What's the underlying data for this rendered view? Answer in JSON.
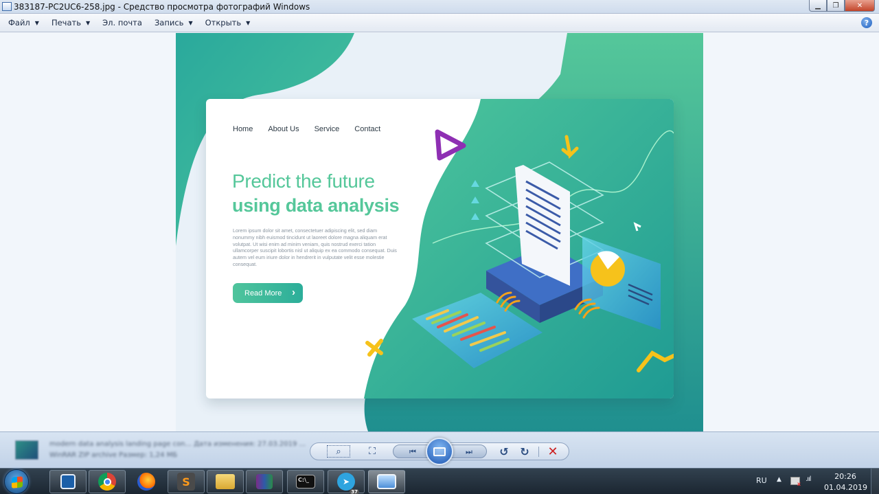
{
  "window": {
    "title": "383187-PC2UC6-258.jpg - Средство просмотра фотографий Windows",
    "minimize_glyph": "▁",
    "maximize_glyph": "❐",
    "close_glyph": "✕"
  },
  "menu": {
    "items": [
      {
        "label": "Файл",
        "dropdown": true
      },
      {
        "label": "Печать",
        "dropdown": true
      },
      {
        "label": "Эл. почта",
        "dropdown": false
      },
      {
        "label": "Запись",
        "dropdown": true
      },
      {
        "label": "Открыть",
        "dropdown": true
      }
    ],
    "dropdown_glyph": "▼",
    "help_glyph": "?"
  },
  "photo": {
    "nav": [
      "Home",
      "About Us",
      "Service",
      "Contact"
    ],
    "headline_light": "Predict the future",
    "headline_bold": "using data analysis",
    "body_text": "Lorem ipsum dolor sit amet, consectetuer adipiscing elit, sed diam nonummy nibh euismod tincidunt ut laoreet dolore magna aliquam erat volutpat. Ut wisi enim ad minim veniam, quis nostrud exerci tation ullamcorper suscipit lobortis nisl ut aliquip ex ea commodo consequat. Duis autem vel eum iriure dolor in hendrerit in vulputate velit esse molestie consequat.",
    "button_label": "Read More",
    "button_glyph": "›",
    "colors": {
      "green": "#55c79a",
      "teal": "#2aa99c",
      "dark_teal": "#1f8f8f"
    }
  },
  "bottom_bar": {
    "file_info_line1": "modern data analysis landing page con...   Дата изменения: 27.03.2019 ...",
    "file_info_line2": "WinRAR ZIP archive                                   Размер: 1,24 МБ",
    "zoom_glyph": "⌕",
    "fit_glyph": "⛶",
    "prev_glyph": "⏮",
    "next_glyph": "⏭",
    "rotate_left_glyph": "↺",
    "rotate_right_glyph": "↻",
    "delete_glyph": "✕"
  },
  "taskbar": {
    "apps": [
      {
        "name": "window-switcher",
        "glyph": ""
      },
      {
        "name": "chrome",
        "glyph": ""
      },
      {
        "name": "firefox",
        "glyph": ""
      },
      {
        "name": "sublime-text",
        "glyph": "S"
      },
      {
        "name": "file-explorer",
        "glyph": ""
      },
      {
        "name": "winrar",
        "glyph": ""
      },
      {
        "name": "command-prompt",
        "glyph": "C:\\_"
      },
      {
        "name": "telegram",
        "glyph": "➤",
        "badge": "37"
      },
      {
        "name": "photo-viewer",
        "glyph": ""
      }
    ],
    "language": "RU",
    "tray_arrow": "▲",
    "signal_glyph": ".ııl",
    "time": "20:26",
    "date": "01.04.2019"
  }
}
